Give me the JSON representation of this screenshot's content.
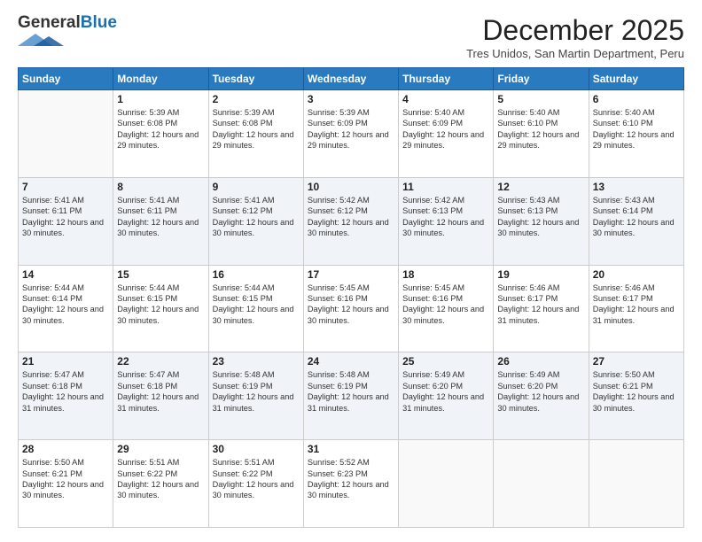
{
  "header": {
    "logo_general": "General",
    "logo_blue": "Blue",
    "month": "December 2025",
    "location": "Tres Unidos, San Martin Department, Peru"
  },
  "days_of_week": [
    "Sunday",
    "Monday",
    "Tuesday",
    "Wednesday",
    "Thursday",
    "Friday",
    "Saturday"
  ],
  "weeks": [
    [
      {
        "day": "",
        "sunrise": "",
        "sunset": "",
        "daylight": ""
      },
      {
        "day": "1",
        "sunrise": "Sunrise: 5:39 AM",
        "sunset": "Sunset: 6:08 PM",
        "daylight": "Daylight: 12 hours and 29 minutes."
      },
      {
        "day": "2",
        "sunrise": "Sunrise: 5:39 AM",
        "sunset": "Sunset: 6:08 PM",
        "daylight": "Daylight: 12 hours and 29 minutes."
      },
      {
        "day": "3",
        "sunrise": "Sunrise: 5:39 AM",
        "sunset": "Sunset: 6:09 PM",
        "daylight": "Daylight: 12 hours and 29 minutes."
      },
      {
        "day": "4",
        "sunrise": "Sunrise: 5:40 AM",
        "sunset": "Sunset: 6:09 PM",
        "daylight": "Daylight: 12 hours and 29 minutes."
      },
      {
        "day": "5",
        "sunrise": "Sunrise: 5:40 AM",
        "sunset": "Sunset: 6:10 PM",
        "daylight": "Daylight: 12 hours and 29 minutes."
      },
      {
        "day": "6",
        "sunrise": "Sunrise: 5:40 AM",
        "sunset": "Sunset: 6:10 PM",
        "daylight": "Daylight: 12 hours and 29 minutes."
      }
    ],
    [
      {
        "day": "7",
        "sunrise": "Sunrise: 5:41 AM",
        "sunset": "Sunset: 6:11 PM",
        "daylight": "Daylight: 12 hours and 30 minutes."
      },
      {
        "day": "8",
        "sunrise": "Sunrise: 5:41 AM",
        "sunset": "Sunset: 6:11 PM",
        "daylight": "Daylight: 12 hours and 30 minutes."
      },
      {
        "day": "9",
        "sunrise": "Sunrise: 5:41 AM",
        "sunset": "Sunset: 6:12 PM",
        "daylight": "Daylight: 12 hours and 30 minutes."
      },
      {
        "day": "10",
        "sunrise": "Sunrise: 5:42 AM",
        "sunset": "Sunset: 6:12 PM",
        "daylight": "Daylight: 12 hours and 30 minutes."
      },
      {
        "day": "11",
        "sunrise": "Sunrise: 5:42 AM",
        "sunset": "Sunset: 6:13 PM",
        "daylight": "Daylight: 12 hours and 30 minutes."
      },
      {
        "day": "12",
        "sunrise": "Sunrise: 5:43 AM",
        "sunset": "Sunset: 6:13 PM",
        "daylight": "Daylight: 12 hours and 30 minutes."
      },
      {
        "day": "13",
        "sunrise": "Sunrise: 5:43 AM",
        "sunset": "Sunset: 6:14 PM",
        "daylight": "Daylight: 12 hours and 30 minutes."
      }
    ],
    [
      {
        "day": "14",
        "sunrise": "Sunrise: 5:44 AM",
        "sunset": "Sunset: 6:14 PM",
        "daylight": "Daylight: 12 hours and 30 minutes."
      },
      {
        "day": "15",
        "sunrise": "Sunrise: 5:44 AM",
        "sunset": "Sunset: 6:15 PM",
        "daylight": "Daylight: 12 hours and 30 minutes."
      },
      {
        "day": "16",
        "sunrise": "Sunrise: 5:44 AM",
        "sunset": "Sunset: 6:15 PM",
        "daylight": "Daylight: 12 hours and 30 minutes."
      },
      {
        "day": "17",
        "sunrise": "Sunrise: 5:45 AM",
        "sunset": "Sunset: 6:16 PM",
        "daylight": "Daylight: 12 hours and 30 minutes."
      },
      {
        "day": "18",
        "sunrise": "Sunrise: 5:45 AM",
        "sunset": "Sunset: 6:16 PM",
        "daylight": "Daylight: 12 hours and 30 minutes."
      },
      {
        "day": "19",
        "sunrise": "Sunrise: 5:46 AM",
        "sunset": "Sunset: 6:17 PM",
        "daylight": "Daylight: 12 hours and 31 minutes."
      },
      {
        "day": "20",
        "sunrise": "Sunrise: 5:46 AM",
        "sunset": "Sunset: 6:17 PM",
        "daylight": "Daylight: 12 hours and 31 minutes."
      }
    ],
    [
      {
        "day": "21",
        "sunrise": "Sunrise: 5:47 AM",
        "sunset": "Sunset: 6:18 PM",
        "daylight": "Daylight: 12 hours and 31 minutes."
      },
      {
        "day": "22",
        "sunrise": "Sunrise: 5:47 AM",
        "sunset": "Sunset: 6:18 PM",
        "daylight": "Daylight: 12 hours and 31 minutes."
      },
      {
        "day": "23",
        "sunrise": "Sunrise: 5:48 AM",
        "sunset": "Sunset: 6:19 PM",
        "daylight": "Daylight: 12 hours and 31 minutes."
      },
      {
        "day": "24",
        "sunrise": "Sunrise: 5:48 AM",
        "sunset": "Sunset: 6:19 PM",
        "daylight": "Daylight: 12 hours and 31 minutes."
      },
      {
        "day": "25",
        "sunrise": "Sunrise: 5:49 AM",
        "sunset": "Sunset: 6:20 PM",
        "daylight": "Daylight: 12 hours and 31 minutes."
      },
      {
        "day": "26",
        "sunrise": "Sunrise: 5:49 AM",
        "sunset": "Sunset: 6:20 PM",
        "daylight": "Daylight: 12 hours and 30 minutes."
      },
      {
        "day": "27",
        "sunrise": "Sunrise: 5:50 AM",
        "sunset": "Sunset: 6:21 PM",
        "daylight": "Daylight: 12 hours and 30 minutes."
      }
    ],
    [
      {
        "day": "28",
        "sunrise": "Sunrise: 5:50 AM",
        "sunset": "Sunset: 6:21 PM",
        "daylight": "Daylight: 12 hours and 30 minutes."
      },
      {
        "day": "29",
        "sunrise": "Sunrise: 5:51 AM",
        "sunset": "Sunset: 6:22 PM",
        "daylight": "Daylight: 12 hours and 30 minutes."
      },
      {
        "day": "30",
        "sunrise": "Sunrise: 5:51 AM",
        "sunset": "Sunset: 6:22 PM",
        "daylight": "Daylight: 12 hours and 30 minutes."
      },
      {
        "day": "31",
        "sunrise": "Sunrise: 5:52 AM",
        "sunset": "Sunset: 6:23 PM",
        "daylight": "Daylight: 12 hours and 30 minutes."
      },
      {
        "day": "",
        "sunrise": "",
        "sunset": "",
        "daylight": ""
      },
      {
        "day": "",
        "sunrise": "",
        "sunset": "",
        "daylight": ""
      },
      {
        "day": "",
        "sunrise": "",
        "sunset": "",
        "daylight": ""
      }
    ]
  ]
}
